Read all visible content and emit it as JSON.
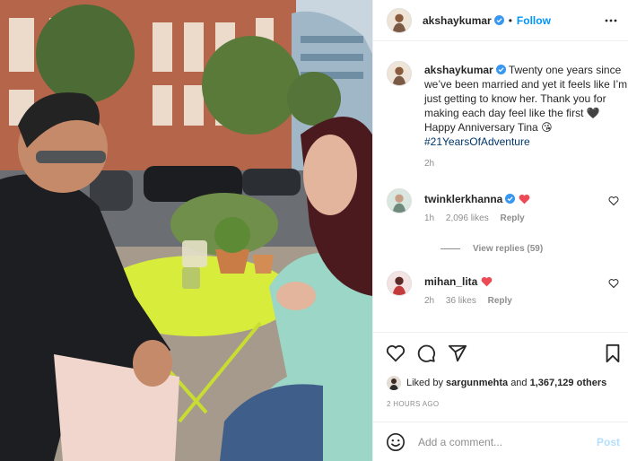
{
  "post": {
    "username": "akshaykumar",
    "follow_label": "Follow",
    "separator": "•"
  },
  "caption": {
    "username": "akshaykumar",
    "text": "Twenty one years since we’ve been married and yet it feels like I’m just getting to know her. Thank you for making each day feel like the first 🖤 Happy Anniversary Tina 😘",
    "hashtag": "#21YearsOfAdventure",
    "time": "2h"
  },
  "comments": [
    {
      "username": "twinklerkhanna",
      "verified": true,
      "time": "1h",
      "likes": "2,096 likes",
      "reply_label": "Reply",
      "view_replies": "View replies (59)"
    },
    {
      "username": "mihan_lita",
      "verified": false,
      "time": "2h",
      "likes": "36 likes",
      "reply_label": "Reply"
    }
  ],
  "likes": {
    "prefix": "Liked by",
    "user": "sargunmehta",
    "middle": "and",
    "count": "1,367,129 others"
  },
  "timestamp": "2 HOURS AGO",
  "add_comment": {
    "placeholder": "Add a comment...",
    "post_label": "Post"
  },
  "icons": {
    "more": "more-horizontal-icon",
    "verified": "verified-badge-icon",
    "heart": "heart-icon",
    "comment": "comment-icon",
    "share": "share-icon",
    "save": "bookmark-icon",
    "emoji": "emoji-icon"
  },
  "colors": {
    "link": "#0095f6",
    "hashtag": "#00376b",
    "secondary_text": "#8e8e8e",
    "heart_red": "#ed4956",
    "post_disabled": "#b2dffc"
  }
}
